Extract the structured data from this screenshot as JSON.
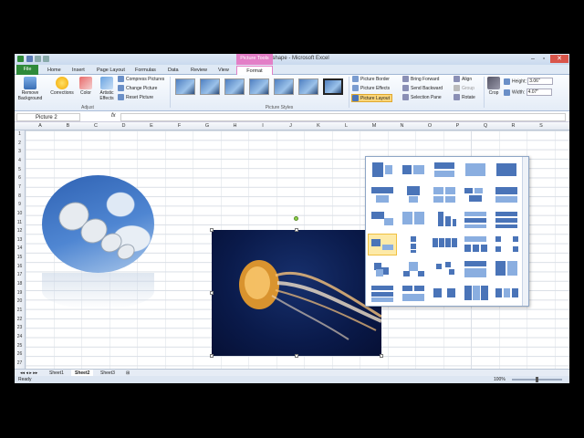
{
  "window": {
    "title": "pic_in_shape - Microsoft Excel",
    "context_tab_group": "Picture Tools"
  },
  "tabs": [
    "File",
    "Home",
    "Insert",
    "Page Layout",
    "Formulas",
    "Data",
    "Review",
    "View",
    "Format"
  ],
  "ribbon": {
    "adjust": {
      "remove_background": "Remove Background",
      "corrections": "Corrections",
      "color": "Color",
      "artistic_effects": "Artistic Effects",
      "compress": "Compress Pictures",
      "change": "Change Picture",
      "reset": "Reset Picture",
      "group_label": "Adjust"
    },
    "picture_styles": {
      "group_label": "Picture Styles"
    },
    "arrange": {
      "border": "Picture Border",
      "effects": "Picture Effects",
      "layout": "Picture Layout",
      "bring_forward": "Bring Forward",
      "send_backward": "Send Backward",
      "selection_pane": "Selection Pane",
      "align": "Align",
      "group": "Group",
      "rotate": "Rotate"
    },
    "size": {
      "crop": "Crop",
      "height_label": "Height:",
      "height_value": "3.06\"",
      "width_label": "Width:",
      "width_value": "4.07\""
    }
  },
  "formula_bar": {
    "name_box": "Picture 2",
    "fx": "fx"
  },
  "columns": [
    "A",
    "B",
    "C",
    "D",
    "E",
    "F",
    "G",
    "H",
    "I",
    "J",
    "K",
    "L",
    "M",
    "N",
    "O",
    "P",
    "Q",
    "R",
    "S"
  ],
  "rows": [
    "1",
    "2",
    "3",
    "4",
    "5",
    "6",
    "7",
    "8",
    "9",
    "10",
    "11",
    "12",
    "13",
    "14",
    "15",
    "16",
    "17",
    "18",
    "19",
    "20",
    "21",
    "22",
    "23",
    "24",
    "25",
    "26",
    "27"
  ],
  "sheets": [
    "Sheet1",
    "Sheet2",
    "Sheet3"
  ],
  "status": {
    "ready": "Ready",
    "zoom": "100%"
  },
  "colors": {
    "file_tab": "#2f8a3a",
    "picture_tools": "#e37fc7",
    "smartart_blue": "#4a74b8"
  }
}
